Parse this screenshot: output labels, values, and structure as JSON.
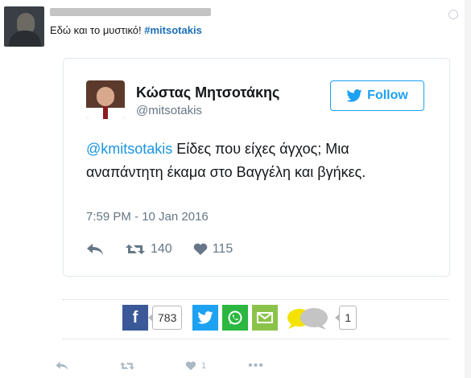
{
  "tweet": {
    "text": "Εδώ και το μυστικό! ",
    "hashtag": "#mitsotakis"
  },
  "embed": {
    "name": "Κώστας Μητσοτάκης",
    "handle": "@mitsotakis",
    "follow_label": "Follow",
    "mention": "@kmitsotakis",
    "body": " Είδες που είχες άγχος; Μια αναπάντητη έκαμα στο Βαγγέλη και βγήκες.",
    "timestamp": "7:59 PM - 10 Jan 2016",
    "retweets": "140",
    "likes": "115"
  },
  "share": {
    "facebook_count": "783",
    "comments_count": "1"
  },
  "footer": {
    "likes": "1"
  },
  "colors": {
    "twitter_blue": "#1da1f2",
    "facebook_blue": "#3b5998",
    "whatsapp_green": "#2bb741",
    "email_green": "#8bc34a"
  }
}
